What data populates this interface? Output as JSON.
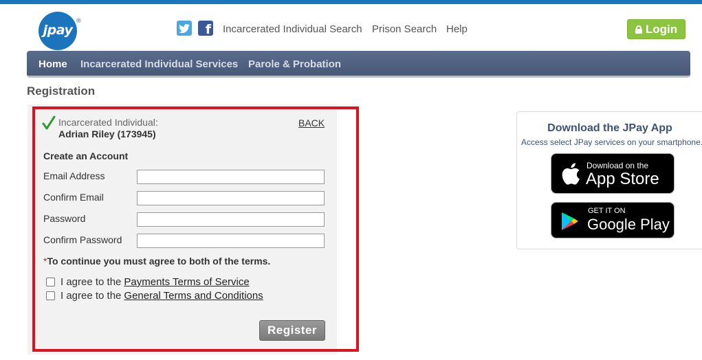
{
  "header": {
    "logo_text": "jpay",
    "logo_reg": "®",
    "links": [
      "Incarcerated Individual Search",
      "Prison Search",
      "Help"
    ],
    "login_label": "Login",
    "facebook_glyph": "f"
  },
  "nav": {
    "items": [
      "Home",
      "Incarcerated Individual Services",
      "Parole & Probation"
    ],
    "active": "Home"
  },
  "page": {
    "title": "Registration"
  },
  "registration": {
    "inmate_label": "Incarcerated Individual:",
    "inmate_name": "Adrian Riley (173945)",
    "back_label": "BACK",
    "create_title": "Create an Account",
    "fields": [
      {
        "label": "Email Address",
        "value": ""
      },
      {
        "label": "Confirm Email",
        "value": ""
      },
      {
        "label": "Password",
        "value": ""
      },
      {
        "label": "Confirm Password",
        "value": ""
      }
    ],
    "terms_required_mark": "*",
    "terms_note": "To continue you must agree to both of the terms.",
    "agree_prefix": "I agree to the",
    "terms": [
      {
        "link": "Payments Terms of Service",
        "checked": false
      },
      {
        "link": "General Terms and Conditions",
        "checked": false
      }
    ],
    "register_label": "Register"
  },
  "app_promo": {
    "title": "Download the JPay App",
    "subtitle": "Access select JPay services on your smartphone.",
    "app_store_small": "Download on the",
    "app_store_big": "App Store",
    "google_play_small": "GET IT ON",
    "google_play_big": "Google Play"
  },
  "colors": {
    "brand_blue": "#1b75bc",
    "nav_bg": "#4f6080",
    "login_green": "#8cc43f",
    "highlight_red": "#e0101d"
  }
}
